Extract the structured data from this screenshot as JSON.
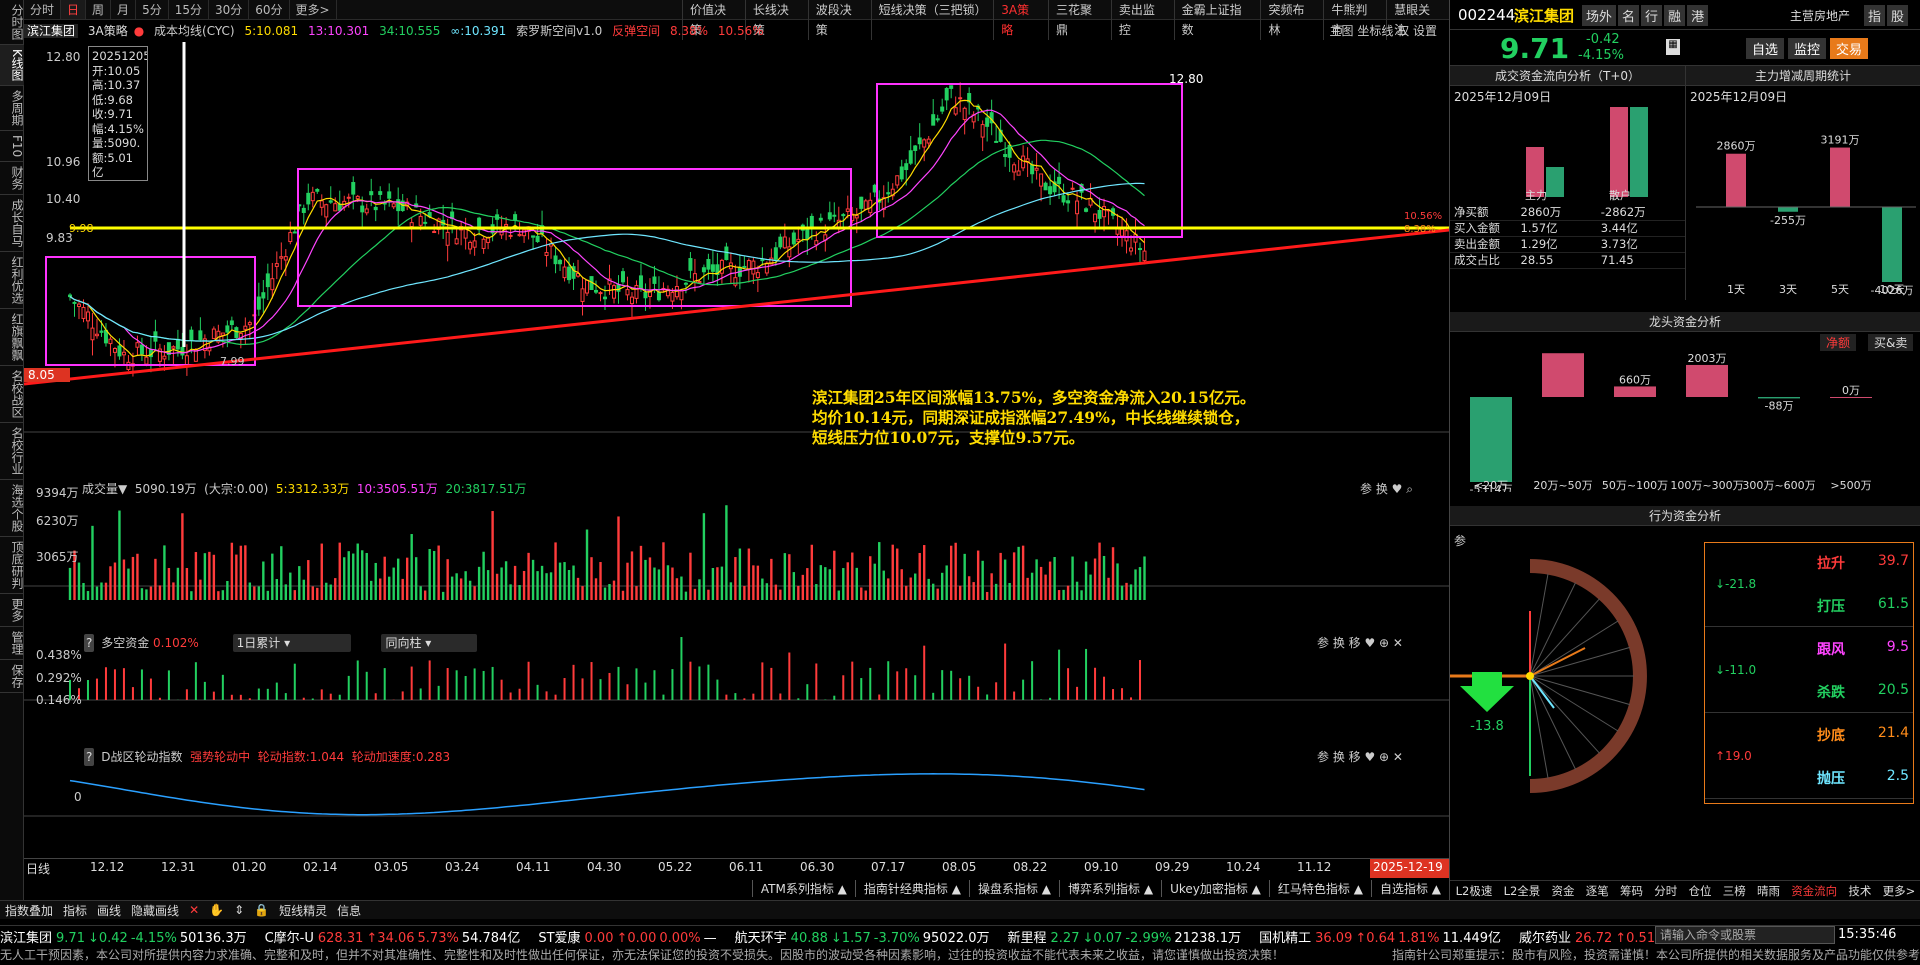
{
  "left_tabs": [
    "分时图",
    "K线图",
    "多周期",
    "F10",
    "财务",
    "成长自马",
    "红利优选",
    "红旗飘飘",
    "名校战区",
    "名校行业",
    "海选个股",
    "顶底研判",
    "更多",
    "管理",
    "保存"
  ],
  "period_tabs": [
    "分时",
    "日",
    "周",
    "月",
    "5分",
    "15分",
    "30分",
    "60分",
    "更多>"
  ],
  "tool_tabs": [
    "价值决策",
    "长线决策",
    "波段决策",
    "短线决策（三把锁）",
    "3A策略",
    "三花聚鼎",
    "卖出监控",
    "金霸上证指数",
    "突频布林",
    "牛熊判市",
    "慧眼关注"
  ],
  "kline_header": {
    "name": "滨江集团",
    "strategy": "3A策略",
    "ma_label": "成本均线(CYC)",
    "ma5": "5:10.081",
    "ma13": "13:10.301",
    "ma34": "34:10.555",
    "mainf": "∞:10.391",
    "indicator": "索罗斯空间v1.0",
    "rebound": "反弹空间",
    "pct1": "8.38%",
    "pct2": "10.56%",
    "right_labels": "主图 坐标线 权 设置"
  },
  "info_box": {
    "date": "20251205",
    "open": "开:10.05",
    "high": "高:10.37",
    "low": "低:9.68",
    "close": "收:9.71",
    "amp": "幅:4.15%",
    "vol": "量:5090.",
    "amt": "额:5.01亿"
  },
  "price_labels": [
    "12.80",
    "10.96",
    "10.40",
    "9.83",
    "8.05"
  ],
  "price_annotations": {
    "high": "12.80",
    "low": "7.99",
    "line": "9.98",
    "r1": "10.56%",
    "r2": "8.38%"
  },
  "comment": [
    "滨江集团25年区间涨幅13.75%，多空资金净流入20.15亿元。",
    "均价10.14元，同期深证成指涨幅27.49%，中长线继续锁仓，",
    "短线压力位10.07元，支撑位9.57元。"
  ],
  "volume_panel": {
    "title": "成交量▼",
    "v": "5090.19万",
    "big": "(大宗:0.00)",
    "m5": "5:3312.33万",
    "m10": "10:3505.51万",
    "m20": "20:3817.51万",
    "y_labels": [
      "9394万",
      "6230万",
      "3065万"
    ],
    "tools": "参 换 ♥ ⌕"
  },
  "money_panel": {
    "title": "多空资金",
    "value": "0.102%",
    "sel1": "1日累计",
    "sel2": "同向柱",
    "y_labels": [
      "0.438%",
      "0.292%",
      "0.146%"
    ],
    "tools": "参 换 移 ♥ ⊕ ✕"
  },
  "rotation_panel": {
    "title": "D战区轮动指数",
    "status": "强势轮动中",
    "idx": "轮动指数:1.044",
    "acc": "轮动加速度:0.283",
    "zero": "0",
    "tools": "参 换 移 ♥ ⊕ ✕"
  },
  "x_axis": {
    "label": "日线",
    "dates": [
      "12.12",
      "12.31",
      "01.20",
      "02.14",
      "03.05",
      "03.24",
      "04.11",
      "04.30",
      "05.22",
      "06.11",
      "06.30",
      "07.17",
      "08.05",
      "08.22",
      "09.10",
      "09.29",
      "10.24",
      "11.12"
    ],
    "current": "2025-12-19 五"
  },
  "indicator_bar": [
    "ATM系列指标 ▲",
    "指南针经典指标 ▲",
    "操盘系指标 ▲",
    "博弈系列指标 ▲",
    "Ukey加密指标 ▲",
    "红马特色指标 ▲",
    "自选指标 ▲"
  ],
  "stock": {
    "code": "002244",
    "name": "滨江集团",
    "tags": [
      "场外",
      "名",
      "行",
      "融",
      "港"
    ],
    "industry": "主营房地产",
    "tools": [
      "指",
      "股"
    ],
    "price": "9.71",
    "change": "-0.42",
    "pct": "-4.15%",
    "buttons": [
      "自选",
      "监控",
      "交易"
    ]
  },
  "flow": {
    "title": "成交资金流向分析（T+0）",
    "date": "2025年12月09日",
    "cols": [
      "主力",
      "散户"
    ],
    "rows": [
      [
        "净买额",
        "2860万",
        "-2862万"
      ],
      [
        "买入金额",
        "1.57亿",
        "3.44亿"
      ],
      [
        "卖出金额",
        "1.29亿",
        "3.73亿"
      ],
      [
        "成交占比",
        "28.55",
        "71.45"
      ]
    ]
  },
  "cycle": {
    "title": "主力增减周期统计",
    "date": "2025年12月09日",
    "items": [
      {
        "label": "1天",
        "value": "2860万",
        "v": 2860
      },
      {
        "label": "3天",
        "value": "-255万",
        "v": -255
      },
      {
        "label": "5天",
        "value": "3191万",
        "v": 3191
      },
      {
        "label": "10天",
        "value": "-4026万",
        "v": -4026
      }
    ]
  },
  "dragon": {
    "title": "龙头资金分析",
    "tabs": [
      "净额",
      "买&卖"
    ],
    "items": [
      {
        "label": "<20万",
        "value": "-5314万",
        "v": -5314
      },
      {
        "label": "20万~50万",
        "value": "2737万",
        "v": 2737
      },
      {
        "label": "50万~100万",
        "value": "660万",
        "v": 660
      },
      {
        "label": "100万~300万",
        "value": "2003万",
        "v": 2003
      },
      {
        "label": "300万~600万",
        "value": "-88万",
        "v": -88
      },
      {
        "label": ">500万",
        "value": "0万",
        "v": 0
      }
    ]
  },
  "behavior": {
    "title": "行为资金分析",
    "legend": [
      {
        "name": "拉升",
        "value": "39.7",
        "color": "#ff3b3b"
      },
      {
        "name": "打压",
        "value": "61.5",
        "color": "#22d060"
      },
      {
        "name": "跟风",
        "value": "9.5",
        "color": "#ff44ff"
      },
      {
        "name": "杀跌",
        "value": "20.5",
        "color": "#22d060"
      },
      {
        "name": "抄底",
        "value": "21.4",
        "color": "#ff8c1a"
      },
      {
        "name": "抛压",
        "value": "2.5",
        "color": "#6fe6ff"
      }
    ],
    "net": [
      "↓-21.8",
      "↓-11.0",
      "↑19.0"
    ],
    "arrow_value": "-13.8",
    "tools": "参"
  },
  "right_tabs": [
    "L2极速",
    "L2全景",
    "资金",
    "逐笔",
    "筹码",
    "分时",
    "仓位",
    "三榜",
    "晴雨",
    "资金流向",
    "技术",
    "更多>"
  ],
  "bottom_tools": [
    "指数叠加",
    "指标",
    "画线",
    "隐藏画线",
    "短线精灵",
    "信息"
  ],
  "ticker": [
    {
      "name": "滨江集团",
      "price": "9.71",
      "chg": "0.42",
      "pct": "-4.15%",
      "amt": "50136.3万",
      "dir": "down"
    },
    {
      "name": "C摩尔-U",
      "price": "628.31",
      "chg": "34.06",
      "pct": "5.73%",
      "amt": "54.784亿",
      "dir": "up"
    },
    {
      "name": "ST爱康",
      "price": "0.00",
      "chg": "0.00",
      "pct": "0.00%",
      "amt": "—",
      "dir": "up"
    },
    {
      "name": "航天环宇",
      "price": "40.88",
      "chg": "1.57",
      "pct": "-3.70%",
      "amt": "95022.0万",
      "dir": "down"
    },
    {
      "name": "新里程",
      "price": "2.27",
      "chg": "0.07",
      "pct": "-2.99%",
      "amt": "21238.1万",
      "dir": "down"
    },
    {
      "name": "国机精工",
      "price": "36.09",
      "chg": "0.64",
      "pct": "1.81%",
      "amt": "11.449亿",
      "dir": "up"
    },
    {
      "name": "威尔药业",
      "price": "26.72",
      "chg": "0.51",
      "pct": "",
      "amt": "",
      "dir": "up"
    }
  ],
  "search_placeholder": "请输入命令或股票",
  "clock": "15:35:46",
  "disclaimer": "无人工干预因素，本公司对所提供内容力求准确、完整和及时，但并不对其准确性、完整性和及时性做出任何保证，亦无法保证您的投资不受损失。因股市的波动受各种因素影响，过往的投资收益不能代表未来之收益，请您谨慎做出投资决策！",
  "disclaimer2": "指南针公司郑重提示：股市有风险，投资需谨慎！本公司所提供的相关数据服务及产品功能仅供参考"
}
